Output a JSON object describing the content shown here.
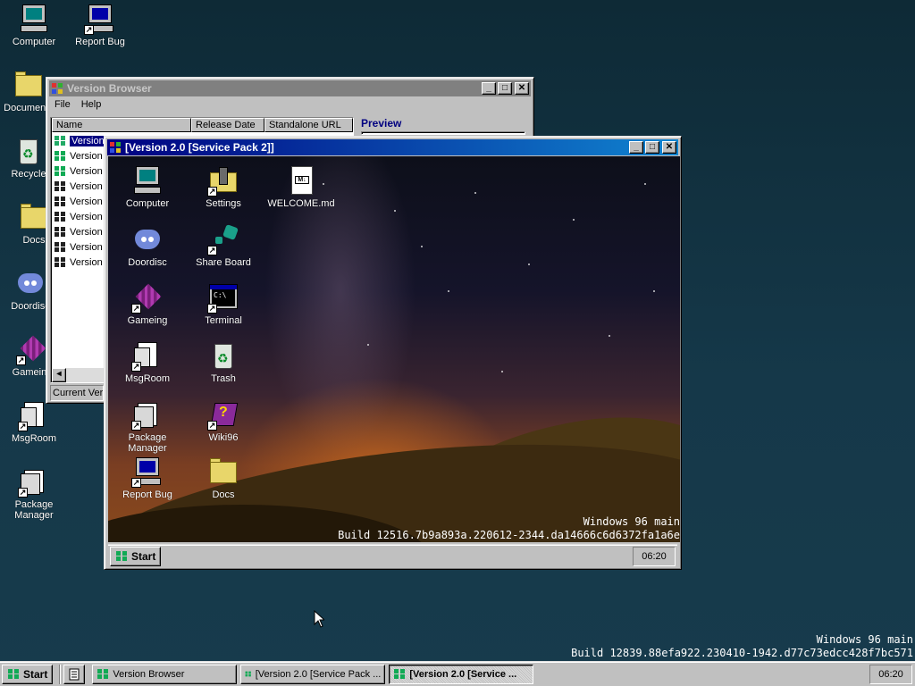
{
  "desktop": {
    "icons": [
      {
        "label": "Computer"
      },
      {
        "label": "Report Bug"
      },
      {
        "label": "Documents"
      },
      {
        "label": "Recycle"
      },
      {
        "label": "Docs"
      },
      {
        "label": "Doordisc"
      },
      {
        "label": "Gameing"
      },
      {
        "label": "MsgRoom"
      },
      {
        "label": "Package Manager"
      }
    ],
    "build_line1": "Windows 96 main",
    "build_line2": "Build 12839.88efa922.230410-1942.d77c73edcc428f7bc571"
  },
  "version_browser": {
    "title": "Version Browser",
    "menu": [
      "File",
      "Help"
    ],
    "columns": [
      "Name",
      "Release Date",
      "Standalone URL"
    ],
    "rows": [
      "Version",
      "Version",
      "Version",
      "Version",
      "Version",
      "Version",
      "Version",
      "Version",
      "Version"
    ],
    "preview_label": "Preview",
    "status": "Current Versi"
  },
  "sp2_window": {
    "title": "[Version 2.0 [Service Pack 2]]",
    "icons": [
      {
        "label": "Computer"
      },
      {
        "label": "Settings"
      },
      {
        "label": "WELCOME.md"
      },
      {
        "label": "Doordisc"
      },
      {
        "label": "Share Board"
      },
      {
        "label": "Gameing"
      },
      {
        "label": "Terminal"
      },
      {
        "label": "MsgRoom"
      },
      {
        "label": "Trash"
      },
      {
        "label": "Package Manager"
      },
      {
        "label": "Wiki96"
      },
      {
        "label": "Report Bug"
      },
      {
        "label": "Docs"
      }
    ],
    "build_line1": "Windows 96 main",
    "build_line2": "Build 12516.7b9a893a.220612-2344.da14666c6d6372fa1a6e",
    "start_label": "Start",
    "clock": "06:20"
  },
  "taskbar": {
    "start_label": "Start",
    "buttons": [
      {
        "label": "Version Browser"
      },
      {
        "label": "[Version 2.0 [Service Pack ..."
      },
      {
        "label": "[Version 2.0 [Service ..."
      }
    ],
    "clock": "06:20"
  },
  "colors": {
    "title_active_start": "#000080",
    "title_active_end": "#1084d0",
    "title_inactive": "#808080",
    "face": "#c0c0c0"
  }
}
